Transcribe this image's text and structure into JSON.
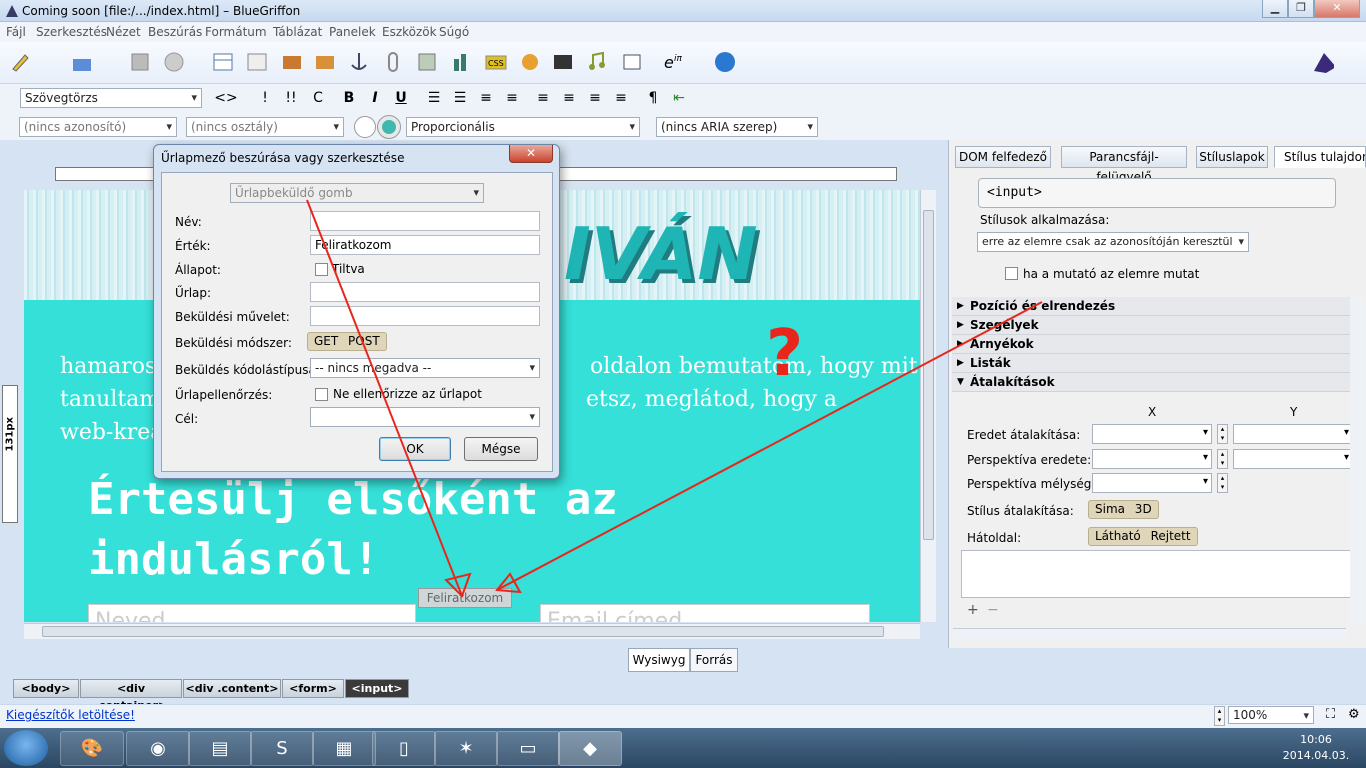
{
  "window": {
    "title": "Coming soon [file:/.../index.html] – BlueGriffon",
    "minimize": "▁",
    "maximize": "❐",
    "close": "✕"
  },
  "menu": [
    "Fájl",
    "Szerkesztés",
    "Nézet",
    "Beszúrás",
    "Formátum",
    "Táblázat",
    "Panelek",
    "Eszközök",
    "Súgó"
  ],
  "format": {
    "paragraph_style": "Szövegtörzs",
    "tag_button": "<>",
    "bold": "B",
    "italic": "I",
    "underline": "U",
    "exclam1": "!",
    "exclam2": "!!",
    "code": "C"
  },
  "attr": {
    "id_select": "(nincs azonosító)",
    "class_select": "(nincs osztály)",
    "font_select": "Proporcionális",
    "aria_select": "(nincs ARIA szerep)"
  },
  "page": {
    "header_text": "IVÁN",
    "paragraph": "hamarosan ... oldalon bemutatom, hogy mit tanultam ... etsz, meglátod, hogy a web-krea...",
    "para_line1": "hamaros",
    "para_line1b": "oldalon bemutatom, hogy mit",
    "para_line2": "tanultam",
    "para_line2b": "etsz, meglátod, hogy a",
    "para_line3": "web-krea",
    "heading_line1": "Értesülj elsőként az",
    "heading_line2": "indulásról!",
    "subscribe_button": "Feliratkozom",
    "name_placeholder": "Neved",
    "email_placeholder": "Email címed",
    "ruler_label": "131px"
  },
  "view_tabs": [
    "Wysiwyg",
    "Forrás"
  ],
  "breadcrumbs": [
    "<body>",
    "<div .container>",
    "<div .content>",
    "<form>",
    "<input>"
  ],
  "status": {
    "link": "Kiegészítők letöltése!",
    "zoom": "100%"
  },
  "right_panel": {
    "tabs": [
      "DOM felfedező",
      "Parancsfájl-felügyelő",
      "Stíluslapok",
      "Stílus tulajdons"
    ],
    "element": "<input>",
    "apply_label": "Stílusok alkalmazása:",
    "apply_value": "erre az elemre csak az azonosítóján keresztül",
    "hover_label": "ha a mutató az elemre mutat",
    "sections": [
      "Pozíció és elrendezés",
      "Szegélyek",
      "Árnyékok",
      "Listák",
      "Átalakítások"
    ],
    "col_x": "X",
    "col_y": "Y",
    "transform_origin": "Eredet átalakítása:",
    "perspective_origin": "Perspektíva eredete:",
    "perspective_depth": "Perspektíva mélysége:",
    "transform_style": "Stílus átalakítása:",
    "transform_style_opts": "Sima  3D",
    "backface": "Hátoldal:",
    "backface_opts": "Látható  Rejtett",
    "add": "+",
    "remove": "−"
  },
  "dialog": {
    "title": "Űrlapmező beszúrása vagy szerkesztése",
    "type_select": "Űrlapbeküldő gomb",
    "name_label": "Név:",
    "name_value": "",
    "value_label": "Érték:",
    "value_value": "Feliratkozom",
    "state_label": "Állapot:",
    "disabled_label": "Tiltva",
    "form_label": "Űrlap:",
    "action_label": "Beküldési művelet:",
    "method_label": "Beküldési módszer:",
    "method_opts": "GET  POST",
    "enctype_label": "Beküldés kódolástípusa:",
    "enctype_value": "-- nincs megadva --",
    "validation_label": "Űrlapellenőrzés:",
    "novalidate_label": "Ne ellenőrizze az űrlapot",
    "target_label": "Cél:",
    "ok": "OK",
    "cancel": "Mégse",
    "close": "✕"
  },
  "annotation": {
    "question_mark": "?",
    "color": "#e8261c"
  },
  "taskbar": {
    "time": "10:06",
    "date": "2014.04.03."
  }
}
